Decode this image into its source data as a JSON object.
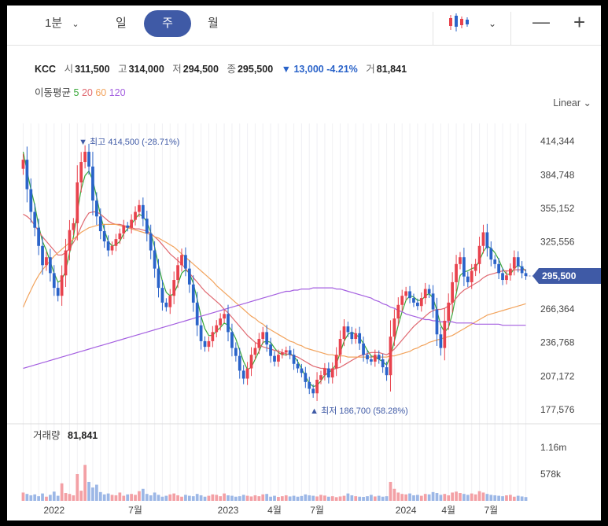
{
  "toolbar": {
    "interval_1min": "1분",
    "tab_day": "일",
    "tab_week": "주",
    "tab_month": "월",
    "minimize": "—",
    "plus": "+"
  },
  "quote": {
    "symbol": "KCC",
    "open_label": "시",
    "open": "311,500",
    "high_label": "고",
    "high": "314,000",
    "low_label": "저",
    "low": "294,500",
    "close_label": "종",
    "close": "295,500",
    "change": "▼ 13,000 -4.21%",
    "volume_label": "거",
    "volume": "81,841"
  },
  "ma": {
    "label": "이동평균",
    "p5": "5",
    "p20": "20",
    "p60": "60",
    "p120": "120"
  },
  "scale_mode": "Linear",
  "colors": {
    "up": "#e8424d",
    "down": "#2a63c9",
    "accent": "#3f5aa6",
    "ma5": "#3aa83a",
    "ma20": "#e06870",
    "ma60": "#f2a35c",
    "ma120": "#a45fe0"
  },
  "chart_data": {
    "type": "candlestick",
    "y_ticks": [
      "414,344",
      "384,748",
      "355,152",
      "325,556",
      "295,500",
      "266,364",
      "236,768",
      "207,172",
      "177,576"
    ],
    "ylim": [
      170000,
      430000
    ],
    "x_ticks": [
      "2022",
      "7월",
      "2023",
      "4월",
      "7월",
      "2024",
      "4월",
      "7월"
    ],
    "last_price_label": "295,500",
    "high_marker": "▼ 최고 414,500 (-28.71%)",
    "low_marker": "▲ 최저 186,700 (58.28%)",
    "close_series": [
      398000,
      372000,
      352000,
      338000,
      322000,
      305000,
      312000,
      298000,
      285000,
      278000,
      296000,
      318000,
      336000,
      342000,
      378000,
      396000,
      405000,
      392000,
      362000,
      348000,
      335000,
      326000,
      318000,
      322000,
      328000,
      333000,
      340000,
      338000,
      345000,
      352000,
      358000,
      346000,
      333000,
      318000,
      302000,
      285000,
      272000,
      268000,
      278000,
      292000,
      305000,
      314000,
      302000,
      288000,
      272000,
      252000,
      238000,
      233000,
      238000,
      246000,
      252000,
      258000,
      262000,
      246000,
      232000,
      225000,
      212000,
      205000,
      214000,
      226000,
      232000,
      240000,
      246000,
      235000,
      225000,
      220000,
      226000,
      228000,
      230000,
      226000,
      218000,
      214000,
      210000,
      202000,
      196000,
      192000,
      204000,
      208000,
      214000,
      206000,
      214000,
      226000,
      240000,
      251000,
      246000,
      240000,
      245000,
      236000,
      226000,
      222000,
      220000,
      226000,
      222000,
      215000,
      208000,
      242000,
      258000,
      270000,
      278000,
      282000,
      276000,
      272000,
      269000,
      276000,
      284000,
      280000,
      266000,
      244000,
      232000,
      256000,
      272000,
      290000,
      306000,
      312000,
      295000,
      290000,
      300000,
      306000,
      322000,
      334000,
      320000,
      310000,
      306000,
      298000,
      292000,
      296000,
      302000,
      312000,
      304000,
      298000,
      295500
    ],
    "ma_series": [
      {
        "name": "5",
        "values": [
          405000,
          388000,
          372000,
          358000,
          340000,
          326000,
          318000,
          308000,
          298000,
          290000,
          292000,
          300000,
          316000,
          330000,
          352000,
          372000,
          384000,
          388000,
          380000,
          365000,
          349000,
          336000,
          326000,
          322000,
          323000,
          326000,
          333000,
          337000,
          341000,
          346000,
          350000,
          348000,
          343000,
          334000,
          321000,
          305000,
          291000,
          281000,
          278000,
          280000,
          288000,
          298000,
          301000,
          298000,
          289000,
          275000,
          260000,
          249000,
          243000,
          243000,
          247000,
          250000,
          254000,
          252000,
          247000,
          240000,
          230000,
          220000,
          213000,
          215000,
          222000,
          229000,
          237000,
          238000,
          237000,
          232000,
          228000,
          226000,
          226000,
          227000,
          225000,
          220000,
          214000,
          207000,
          201000,
          198000,
          199000,
          203000,
          208000,
          210000,
          213000,
          218000,
          228000,
          238000,
          244000,
          246000,
          244000,
          241000,
          236000,
          230000,
          225000,
          224000,
          222000,
          220000,
          217000,
          225000,
          238000,
          252000,
          264000,
          274000,
          278000,
          277000,
          274000,
          274000,
          278000,
          280000,
          276000,
          265000,
          252000,
          246000,
          250000,
          262000,
          280000,
          296000,
          299000,
          300000,
          302000,
          303000,
          309000,
          317000,
          322000,
          320000,
          316000,
          310000,
          302000,
          297000,
          297000,
          302000,
          305000,
          303000,
          300000
        ]
      },
      {
        "name": "20",
        "values": [
          350000,
          348000,
          345000,
          340000,
          335000,
          330000,
          326000,
          322000,
          318000,
          314000,
          314000,
          316000,
          320000,
          325000,
          331000,
          339000,
          346000,
          351000,
          352000,
          352000,
          350000,
          347000,
          344000,
          342000,
          341000,
          341000,
          340000,
          339000,
          338000,
          337000,
          337000,
          336000,
          335000,
          333000,
          330000,
          327000,
          323000,
          319000,
          315000,
          312000,
          309000,
          306000,
          302000,
          298000,
          294000,
          290000,
          286000,
          282000,
          279000,
          276000,
          273000,
          270000,
          266000,
          263000,
          259000,
          255000,
          251000,
          247000,
          243000,
          240000,
          237000,
          235000,
          233000,
          232000,
          231000,
          230000,
          229000,
          228000,
          227000,
          226000,
          225000,
          224000,
          222000,
          220000,
          218000,
          216000,
          215000,
          214000,
          214000,
          213000,
          213000,
          214000,
          215000,
          217000,
          219000,
          221000,
          223000,
          225000,
          226000,
          227000,
          228000,
          228000,
          228000,
          227000,
          226000,
          228000,
          231000,
          235000,
          239000,
          243000,
          247000,
          251000,
          254000,
          257000,
          260000,
          263000,
          265000,
          266000,
          266000,
          267000,
          269000,
          272000,
          276000,
          280000,
          283000,
          285000,
          287000,
          289000,
          291000,
          294000,
          296000,
          297000,
          298000,
          299000,
          300000,
          300000,
          300000,
          301000,
          301000,
          301000,
          301000
        ]
      },
      {
        "name": "60",
        "values": [
          268000,
          276000,
          283000,
          290000,
          296000,
          301000,
          305000,
          309000,
          313000,
          316000,
          319000,
          322000,
          325000,
          328000,
          331000,
          334000,
          336000,
          338000,
          339000,
          340000,
          341000,
          341000,
          341000,
          341000,
          341000,
          340000,
          339000,
          338000,
          337000,
          336000,
          335000,
          334000,
          333000,
          332000,
          330000,
          329000,
          327000,
          325000,
          323000,
          321000,
          318000,
          315000,
          312000,
          309000,
          306000,
          303000,
          300000,
          297000,
          294000,
          291000,
          287000,
          284000,
          281000,
          278000,
          275000,
          272000,
          269000,
          266000,
          263000,
          260000,
          258000,
          255000,
          253000,
          250000,
          248000,
          246000,
          244000,
          242000,
          240000,
          238000,
          237000,
          235000,
          234000,
          232000,
          231000,
          230000,
          229000,
          228000,
          227000,
          226000,
          226000,
          225000,
          225000,
          225000,
          224000,
          224000,
          224000,
          224000,
          224000,
          224000,
          224000,
          224000,
          224000,
          224000,
          224000,
          225000,
          225000,
          226000,
          227000,
          228000,
          229000,
          231000,
          232000,
          234000,
          235000,
          237000,
          238000,
          239000,
          240000,
          241000,
          242000,
          243000,
          245000,
          247000,
          249000,
          251000,
          253000,
          255000,
          257000,
          259000,
          261000,
          262000,
          263000,
          264000,
          265000,
          266000,
          267000,
          268000,
          269000,
          270000,
          271000
        ]
      },
      {
        "name": "120",
        "values": [
          214000,
          215000,
          216000,
          217000,
          218000,
          219000,
          220000,
          221000,
          222000,
          223000,
          224000,
          225000,
          226000,
          227000,
          228000,
          229000,
          230000,
          231000,
          232000,
          233000,
          234000,
          235000,
          236000,
          237000,
          238000,
          239000,
          240000,
          241000,
          242000,
          243000,
          244000,
          245000,
          246000,
          247000,
          248000,
          249000,
          250000,
          251000,
          252000,
          253000,
          254000,
          255000,
          256000,
          257000,
          258000,
          259000,
          260000,
          261000,
          262000,
          263000,
          264000,
          265000,
          266000,
          267000,
          268000,
          269000,
          270000,
          271000,
          272000,
          273000,
          274000,
          275000,
          276000,
          277000,
          278000,
          279000,
          280000,
          281000,
          282000,
          282000,
          283000,
          283000,
          284000,
          284000,
          284000,
          285000,
          285000,
          285000,
          285000,
          285000,
          285000,
          284000,
          284000,
          283000,
          282000,
          281000,
          280000,
          279000,
          278000,
          277000,
          276000,
          274000,
          273000,
          271000,
          270000,
          268000,
          267000,
          265000,
          264000,
          262000,
          261000,
          260000,
          259000,
          258000,
          257000,
          257000,
          256000,
          256000,
          255000,
          255000,
          255000,
          255000,
          254000,
          254000,
          254000,
          254000,
          254000,
          253000,
          253000,
          253000,
          253000,
          253000,
          253000,
          253000,
          252000,
          252000,
          252000,
          252000,
          252000,
          252000,
          252000
        ]
      }
    ],
    "volume_panel": {
      "label": "거래량",
      "value": "81,841",
      "y_ticks": [
        "1.16m",
        "578k"
      ],
      "ylim": [
        0,
        1450000
      ],
      "values": [
        180000,
        150000,
        120000,
        140000,
        100000,
        160000,
        90000,
        130000,
        200000,
        110000,
        380000,
        170000,
        150000,
        120000,
        580000,
        220000,
        780000,
        410000,
        290000,
        350000,
        190000,
        140000,
        160000,
        130000,
        120000,
        180000,
        110000,
        140000,
        150000,
        130000,
        210000,
        260000,
        150000,
        120000,
        180000,
        130000,
        90000,
        110000,
        140000,
        160000,
        120000,
        90000,
        130000,
        110000,
        100000,
        150000,
        120000,
        90000,
        110000,
        140000,
        130000,
        100000,
        160000,
        120000,
        110000,
        90000,
        100000,
        130000,
        110000,
        95000,
        120000,
        100000,
        140000,
        150000,
        90000,
        110000,
        85000,
        100000,
        120000,
        95000,
        110000,
        90000,
        105000,
        140000,
        120000,
        110000,
        95000,
        130000,
        115000,
        90000,
        100000,
        80000,
        95000,
        110000,
        160000,
        120000,
        100000,
        90000,
        85000,
        100000,
        130000,
        95000,
        110000,
        90000,
        100000,
        410000,
        260000,
        180000,
        150000,
        140000,
        160000,
        120000,
        130000,
        110000,
        150000,
        140000,
        190000,
        170000,
        130000,
        150000,
        120000,
        180000,
        200000,
        170000,
        150000,
        130000,
        160000,
        140000,
        210000,
        180000,
        150000,
        130000,
        120000,
        110000,
        100000,
        120000,
        130000,
        90000,
        110000,
        95000,
        81841
      ]
    }
  }
}
